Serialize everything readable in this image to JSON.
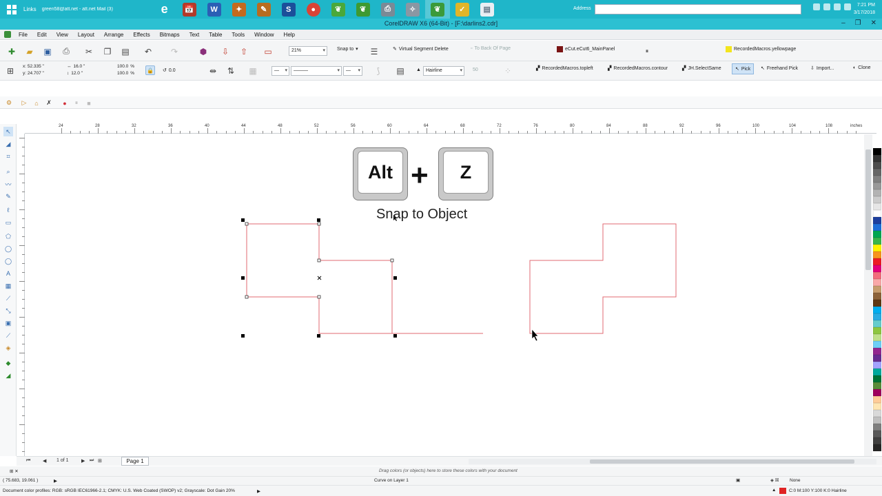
{
  "taskbar": {
    "links_label": "Links",
    "mail_label": "green58@att.net - att.net Mail (3)",
    "address_label": "Address",
    "clock_time": "7:21 PM",
    "clock_date": "3/17/2018",
    "apps": [
      "ie-icon",
      "calendar-icon",
      "word-icon",
      "wrench-icon",
      "pen-icon",
      "app-s-icon",
      "chrome-icon",
      "leaf-icon",
      "leaf-icon",
      "printer-icon",
      "paint-icon",
      "coreldraw-icon",
      "check-icon",
      "document-icon"
    ]
  },
  "window": {
    "title": "CorelDRAW X6 (64-Bit) - [F:\\darlins2.cdr]",
    "min": "–",
    "max": "❐",
    "close": "✕"
  },
  "menu": [
    "File",
    "Edit",
    "View",
    "Layout",
    "Arrange",
    "Effects",
    "Bitmaps",
    "Text",
    "Table",
    "Tools",
    "Window",
    "Help"
  ],
  "toolbar1": {
    "zoom": "21%",
    "snap_to": "Snap to",
    "virtual_segment_delete": "Virtual Segment Delete",
    "to_back_of_page": "To Back Of Page",
    "ecut_panel": "eCut.eCut6_MainPanel",
    "yellowpage": "RecordedMacros.yellowpage"
  },
  "toolbar2": {
    "x": "x: 52.335 \"",
    "y": "y: 24.707 \"",
    "w": "16.0 \"",
    "h": "12.0 \"",
    "scale_x": "100.0",
    "scale_y": "100.0",
    "pct": "%",
    "angle": "0.0",
    "outline": "Hairline",
    "outline_val": "50",
    "macros": [
      "RecordedMacros.topleft",
      "RecordedMacros.contour",
      "JH.SelectSame",
      "Pick",
      "Freehand Pick",
      "Import...",
      "Clone"
    ]
  },
  "ruler": {
    "h_labels": [
      "24",
      "28",
      "32",
      "36",
      "40",
      "44",
      "48",
      "52",
      "56",
      "60",
      "64",
      "68",
      "72",
      "76",
      "80",
      "84",
      "88",
      "92",
      "96",
      "100",
      "104",
      "108"
    ],
    "unit": "inches"
  },
  "overlay": {
    "key1": "Alt",
    "plus": "+",
    "key2": "Z",
    "caption": "Snap to Object"
  },
  "pagebar": {
    "page_count": "1 of 1",
    "page_tab": "Page 1"
  },
  "status": {
    "palette_hint": "Drag colors (or objects) here to store these colors with your document",
    "coords": "( 75.683, 19.061 )",
    "object_info": "Curve on Layer 1",
    "fill": "None",
    "color_profiles": "Document color profiles: RGB: sRGB IEC61966-2.1; CMYK: U.S. Web Coated (SWOP) v2; Grayscale: Dot Gain 20%",
    "outline_info": "C:0 M:100 Y:100 K:0  Hairline"
  },
  "colors": {
    "taskbar": "#1fb6c9",
    "shape_outline": "#e06a72",
    "selection_handle": "#000000"
  }
}
